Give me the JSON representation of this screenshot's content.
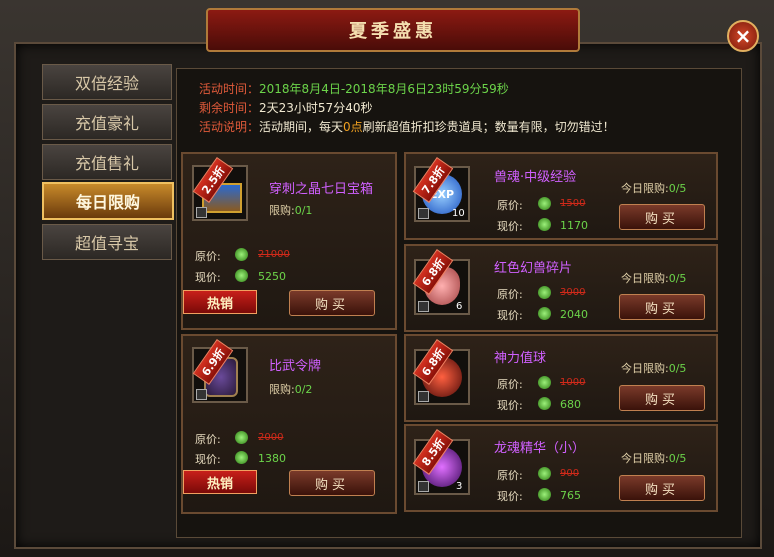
{
  "window": {
    "title": "夏季盛惠",
    "close_glyph": "×"
  },
  "tabs": [
    "双倍经验",
    "充值豪礼",
    "充值售礼",
    "每日限购",
    "超值寻宝"
  ],
  "info": {
    "time_label": "活动时间：",
    "time_value": "2018年8月4日-2018年8月6日23时59分59秒",
    "remain_label": "剩余时间：",
    "remain_value": "2天23小时57分40秒",
    "desc_label": "活动说明：",
    "desc_a": "活动期间，每天",
    "desc_hl": "0点",
    "desc_b": "刷新超值折扣珍贵道具；数量有限，切勿错过！"
  },
  "labels": {
    "original": "原价:",
    "current": "现价:",
    "limit": "限购:",
    "today_limit": "今日限购:",
    "buy": "购买",
    "hot": "热销"
  },
  "items": [
    {
      "name": "穿刺之晶七日宝箱",
      "discount": "2.5折",
      "limit": "0/1",
      "old": "21000",
      "new": "5250",
      "qty": ""
    },
    {
      "name": "比武令牌",
      "discount": "6.9折",
      "limit": "0/2",
      "old": "2000",
      "new": "1380",
      "qty": ""
    },
    {
      "name": "兽魂·中级经验",
      "discount": "7.8折",
      "limit": "0/5",
      "old": "1500",
      "new": "1170",
      "qty": "10",
      "icon_text": "EXP"
    },
    {
      "name": "红色幻兽碎片",
      "discount": "6.8折",
      "limit": "0/5",
      "old": "3000",
      "new": "2040",
      "qty": "6"
    },
    {
      "name": "神力值球",
      "discount": "6.8折",
      "limit": "0/5",
      "old": "1000",
      "new": "680",
      "qty": ""
    },
    {
      "name": "龙魂精华（小）",
      "discount": "8.5折",
      "limit": "0/5",
      "old": "900",
      "new": "765",
      "qty": "3"
    }
  ],
  "colors": {
    "accent": "#c88a2a",
    "name": "#d060ff",
    "price_new": "#6cd44a",
    "price_old": "#d02a1a"
  }
}
